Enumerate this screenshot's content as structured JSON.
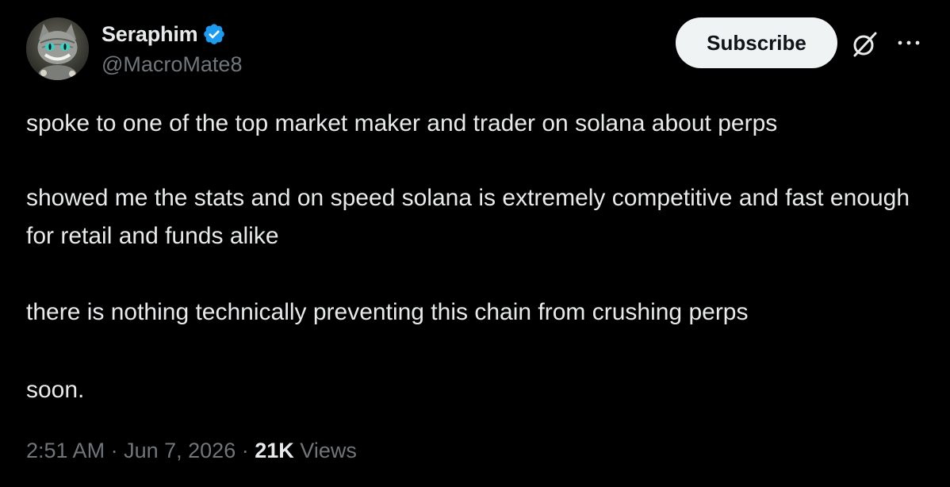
{
  "author": {
    "display_name": "Seraphim",
    "handle": "@MacroMate8",
    "verified_badge_icon": "verified-badge-icon",
    "avatar_icon": "cat-avatar"
  },
  "actions": {
    "subscribe_label": "Subscribe",
    "grok_icon": "grok-icon",
    "more_icon": "more-options-icon"
  },
  "post": {
    "paragraphs": [
      "spoke to one of the top market maker and trader on solana about perps",
      "showed me the stats and on speed solana is extremely competitive and fast enough for retail and funds alike",
      "there is nothing technically preventing this chain from crushing perps",
      "soon."
    ]
  },
  "meta": {
    "time": "2:51 AM",
    "separator": "·",
    "date": "Jun 7, 2026",
    "views_count": "21K",
    "views_label": "Views"
  },
  "colors": {
    "background": "#000000",
    "text_primary": "#e7e9ea",
    "text_secondary": "#71767b",
    "verified_blue": "#1d9bf0",
    "button_bg": "#eff3f4"
  }
}
